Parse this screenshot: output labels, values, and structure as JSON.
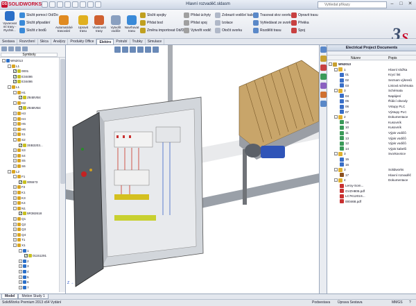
{
  "app": {
    "title": "Hlavní rozvaděč.sldasm",
    "logo": "SOLIDWORKS",
    "search_placeholder": "Vyhledat příkazy"
  },
  "ribbon": {
    "big_left": [
      {
        "label": "Vyvarovat mí trasy - Rychlé..."
      }
    ],
    "group1": [
      "Složit pomocí Od/Do",
      "Složit připadání",
      "Složit z bodů"
    ],
    "group2": [
      {
        "label": "Automatické trasování"
      },
      {
        "label": "Upravit trasu"
      },
      {
        "label": "Vlastnosti trasy"
      },
      {
        "label": "Vytvořit vodiče"
      },
      {
        "label": "Navrhovat trasu"
      }
    ],
    "group3": [
      "Složit spojky",
      "Přidat bod",
      "Změnu importovat Od/Do"
    ],
    "group4": [
      "Přidat úchyty",
      "Přidat spoj",
      "Vytvořit vodič"
    ],
    "group5": [
      "Zobrazit vodiče/ kabely",
      "Izolace",
      "Otočit svorku"
    ],
    "group6": [
      "Trasovat skrz svorku",
      "Vyhledávat ze svorky",
      "Rozdělit trasu"
    ],
    "group7": [
      "Opravit trasu",
      "Překka",
      "Spoj"
    ]
  },
  "tabs": [
    "Sestava",
    "Rozvržení",
    "Skica",
    "Analýzy",
    "Produkty Office",
    "Elektro",
    "Potrubí",
    "Trubky",
    "Simulace"
  ],
  "tabs_active": "Elektro",
  "tree": {
    "column": "Symboly",
    "rows": [
      {
        "indent": 0,
        "pm": "-",
        "check": false,
        "label": "WN2013",
        "icon": "#2b6fc8"
      },
      {
        "indent": 1,
        "pm": "-",
        "check": false,
        "label": "L1",
        "icon": "#d9a520"
      },
      {
        "indent": 2,
        "pm": "",
        "check": true,
        "label": "0001",
        "icon": "#c8c020"
      },
      {
        "indent": 2,
        "pm": "",
        "check": true,
        "label": "E34486",
        "icon": "#c8c020"
      },
      {
        "indent": 2,
        "pm": "",
        "check": true,
        "label": "E34486",
        "icon": "#c8c020"
      },
      {
        "indent": 1,
        "pm": "-",
        "check": false,
        "label": "L1",
        "icon": "#d9a520"
      },
      {
        "indent": 2,
        "pm": "-",
        "check": false,
        "label": "H1",
        "icon": "#d9a520"
      },
      {
        "indent": 3,
        "pm": "",
        "check": true,
        "label": "Z84BVB4",
        "icon": "#c8c020"
      },
      {
        "indent": 2,
        "pm": "-",
        "check": false,
        "label": "H2",
        "icon": "#d9a520"
      },
      {
        "indent": 3,
        "pm": "",
        "check": true,
        "label": "Z84BVB4",
        "icon": "#c8c020"
      },
      {
        "indent": 2,
        "pm": "+",
        "check": false,
        "label": "H3",
        "icon": "#d9a520"
      },
      {
        "indent": 2,
        "pm": "+",
        "check": false,
        "label": "H4",
        "icon": "#d9a520"
      },
      {
        "indent": 2,
        "pm": "+",
        "check": false,
        "label": "H5",
        "icon": "#d9a520"
      },
      {
        "indent": 2,
        "pm": "+",
        "check": false,
        "label": "H6",
        "icon": "#d9a520"
      },
      {
        "indent": 2,
        "pm": "+",
        "check": false,
        "label": "S1",
        "icon": "#d9a520"
      },
      {
        "indent": 2,
        "pm": "-",
        "check": false,
        "label": "S2",
        "icon": "#d9a520"
      },
      {
        "indent": 3,
        "pm": "",
        "check": true,
        "label": "3SB3203...",
        "icon": "#c8c020"
      },
      {
        "indent": 2,
        "pm": "+",
        "check": false,
        "label": "S3",
        "icon": "#d9a520"
      },
      {
        "indent": 2,
        "pm": "+",
        "check": false,
        "label": "S4",
        "icon": "#d9a520"
      },
      {
        "indent": 2,
        "pm": "+",
        "check": false,
        "label": "S5",
        "icon": "#d9a520"
      },
      {
        "indent": 2,
        "pm": "+",
        "check": false,
        "label": "S6",
        "icon": "#d9a520"
      },
      {
        "indent": 1,
        "pm": "-",
        "check": false,
        "label": "L2",
        "icon": "#d9a520"
      },
      {
        "indent": 2,
        "pm": "-",
        "check": false,
        "label": "F1",
        "icon": "#d9a520"
      },
      {
        "indent": 3,
        "pm": "",
        "check": true,
        "label": "005573",
        "icon": "#c8c020"
      },
      {
        "indent": 2,
        "pm": "+",
        "check": false,
        "label": "F2",
        "icon": "#d9a520"
      },
      {
        "indent": 2,
        "pm": "+",
        "check": false,
        "label": "K1",
        "icon": "#d9a520"
      },
      {
        "indent": 2,
        "pm": "+",
        "check": false,
        "label": "K3",
        "icon": "#d9a520"
      },
      {
        "indent": 2,
        "pm": "+",
        "check": false,
        "label": "K4",
        "icon": "#d9a520"
      },
      {
        "indent": 2,
        "pm": "-",
        "check": false,
        "label": "N1",
        "icon": "#d9a520"
      },
      {
        "indent": 3,
        "pm": "",
        "check": true,
        "label": "5R382618",
        "icon": "#c8c020"
      },
      {
        "indent": 2,
        "pm": "+",
        "check": false,
        "label": "Q1",
        "icon": "#d9a520"
      },
      {
        "indent": 2,
        "pm": "+",
        "check": false,
        "label": "Q2",
        "icon": "#d9a520"
      },
      {
        "indent": 2,
        "pm": "+",
        "check": false,
        "label": "Q3",
        "icon": "#d9a520"
      },
      {
        "indent": 2,
        "pm": "+",
        "check": false,
        "label": "Q4",
        "icon": "#d9a520"
      },
      {
        "indent": 2,
        "pm": "+",
        "check": false,
        "label": "T1",
        "icon": "#d9a520"
      },
      {
        "indent": 2,
        "pm": "-",
        "check": false,
        "label": "X1",
        "icon": "#d9a520"
      },
      {
        "indent": 3,
        "pm": "-",
        "check": false,
        "label": "1",
        "icon": "#2b6fc8"
      },
      {
        "indent": 4,
        "pm": "",
        "check": true,
        "label": "01151291",
        "icon": "#c8c020"
      },
      {
        "indent": 3,
        "pm": "+",
        "check": false,
        "label": "2",
        "icon": "#2b6fc8"
      },
      {
        "indent": 3,
        "pm": "+",
        "check": false,
        "label": "3",
        "icon": "#2b6fc8"
      },
      {
        "indent": 3,
        "pm": "+",
        "check": false,
        "label": "4",
        "icon": "#2b6fc8"
      },
      {
        "indent": 3,
        "pm": "+",
        "check": false,
        "label": "5",
        "icon": "#2b6fc8"
      },
      {
        "indent": 3,
        "pm": "+",
        "check": false,
        "label": "6",
        "icon": "#2b6fc8"
      },
      {
        "indent": 3,
        "pm": "+",
        "check": false,
        "label": "7",
        "icon": "#2b6fc8"
      }
    ]
  },
  "panel": {
    "title": "Electrical Project Documents",
    "col_name": "Název",
    "col_desc": "Popis",
    "rows": [
      {
        "indent": 0,
        "pm": "-",
        "num": "WN2013",
        "desc": "",
        "icon": "#c8a030",
        "bold": true
      },
      {
        "indent": 1,
        "pm": "-",
        "num": "1",
        "desc": "Hlavní složka",
        "icon": "#e0b030"
      },
      {
        "indent": 2,
        "pm": "",
        "num": "01",
        "desc": "Krycí list",
        "icon": "#3a6fc8"
      },
      {
        "indent": 2,
        "pm": "",
        "num": "02",
        "desc": "Seznam výkresů",
        "icon": "#3a6fc8"
      },
      {
        "indent": 2,
        "pm": "",
        "num": "03",
        "desc": "Liniová schémata",
        "icon": "#3a6fc8"
      },
      {
        "indent": 1,
        "pm": "-",
        "num": "3",
        "desc": "Schémata",
        "icon": "#e0b030"
      },
      {
        "indent": 2,
        "pm": "",
        "num": "04",
        "desc": "Napájení",
        "icon": "#3a6fc8"
      },
      {
        "indent": 2,
        "pm": "",
        "num": "05",
        "desc": "Řídicí obvody",
        "icon": "#3a6fc8"
      },
      {
        "indent": 2,
        "pm": "",
        "num": "06",
        "desc": "Vstupy PLC",
        "icon": "#3a6fc8"
      },
      {
        "indent": 2,
        "pm": "",
        "num": "07",
        "desc": "Výstupy PLC",
        "icon": "#3a6fc8"
      },
      {
        "indent": 1,
        "pm": "-",
        "num": "2",
        "desc": "Dokumentace",
        "icon": "#e0b030"
      },
      {
        "indent": 2,
        "pm": "",
        "num": "09",
        "desc": "Kusovník",
        "icon": "#3a9a58"
      },
      {
        "indent": 2,
        "pm": "",
        "num": "10",
        "desc": "Kusovník",
        "icon": "#3a9a58"
      },
      {
        "indent": 2,
        "pm": "",
        "num": "11",
        "desc": "Výpis vodičů",
        "icon": "#3a9a58"
      },
      {
        "indent": 2,
        "pm": "",
        "num": "13",
        "desc": "Výpis vodičů",
        "icon": "#3a9a58"
      },
      {
        "indent": 2,
        "pm": "",
        "num": "12",
        "desc": "Výpis vodičů",
        "icon": "#3a9a58"
      },
      {
        "indent": 2,
        "pm": "",
        "num": "14",
        "desc": "Výpis kabelů",
        "icon": "#3a9a58"
      },
      {
        "indent": 1,
        "pm": "-",
        "num": "3",
        "desc": "Svorkovnice",
        "icon": "#e0b030"
      },
      {
        "indent": 2,
        "pm": "",
        "num": "15",
        "desc": "",
        "icon": "#3a6fc8"
      },
      {
        "indent": 2,
        "pm": "",
        "num": "16",
        "desc": "",
        "icon": "#3a6fc8"
      },
      {
        "indent": 1,
        "pm": "-",
        "num": "3",
        "desc": "Solidworks",
        "icon": "#e0b030"
      },
      {
        "indent": 2,
        "pm": "",
        "num": "17",
        "desc": "Hlavní rozvaděč",
        "icon": "#8a5020"
      },
      {
        "indent": 1,
        "pm": "-",
        "num": "4",
        "desc": "Dokumentace",
        "icon": "#e0b030"
      },
      {
        "indent": 2,
        "pm": "",
        "num": "Leroy-Som...",
        "desc": "",
        "icon": "#c83030"
      },
      {
        "indent": 2,
        "pm": "",
        "num": "GVZH806.pdf",
        "desc": "",
        "icon": "#c83030"
      },
      {
        "indent": 2,
        "pm": "",
        "num": "LC7K1201S...",
        "desc": "",
        "icon": "#c83030"
      },
      {
        "indent": 2,
        "pm": "",
        "num": "000468.pdf",
        "desc": "",
        "icon": "#c83030"
      }
    ]
  },
  "bottom_tabs": [
    "Model",
    "Motion Study 1"
  ],
  "bottom_tabs_active": "Model",
  "status": {
    "left": "SolidWorks Premium 2013 x64 Vydání",
    "mid1": "Podsestava",
    "mid2": "Úprava Sestava",
    "units": "MMGS",
    "help": "?"
  },
  "viewport": {
    "axis_label": "Z"
  }
}
